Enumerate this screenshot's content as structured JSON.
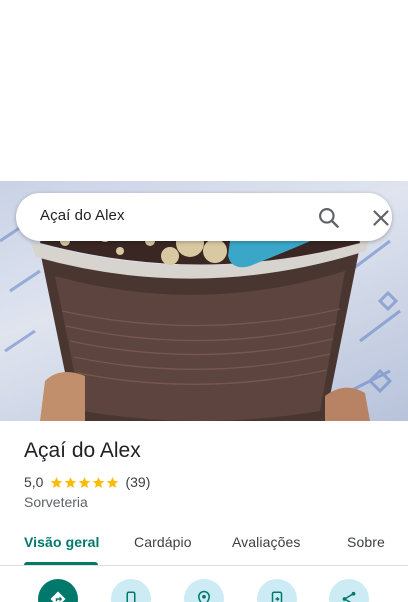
{
  "search": {
    "query": "Açaí do Alex"
  },
  "place": {
    "name": "Açaí do Alex",
    "rating": "5,0",
    "stars": 5,
    "review_count": "(39)",
    "category": "Sorveteria"
  },
  "tabs": [
    {
      "label": "Visão geral",
      "active": true
    },
    {
      "label": "Cardápio",
      "active": false
    },
    {
      "label": "Avaliações",
      "active": false
    },
    {
      "label": "Sobre",
      "active": false
    }
  ],
  "actions": [
    {
      "icon": "directions-icon"
    },
    {
      "icon": "phone-icon"
    },
    {
      "icon": "location-pin-icon"
    },
    {
      "icon": "save-to-phone-icon"
    },
    {
      "icon": "share-icon"
    }
  ],
  "colors": {
    "accent": "#00796b",
    "star": "#fbbc04",
    "action_bg": "#cdebf5"
  }
}
